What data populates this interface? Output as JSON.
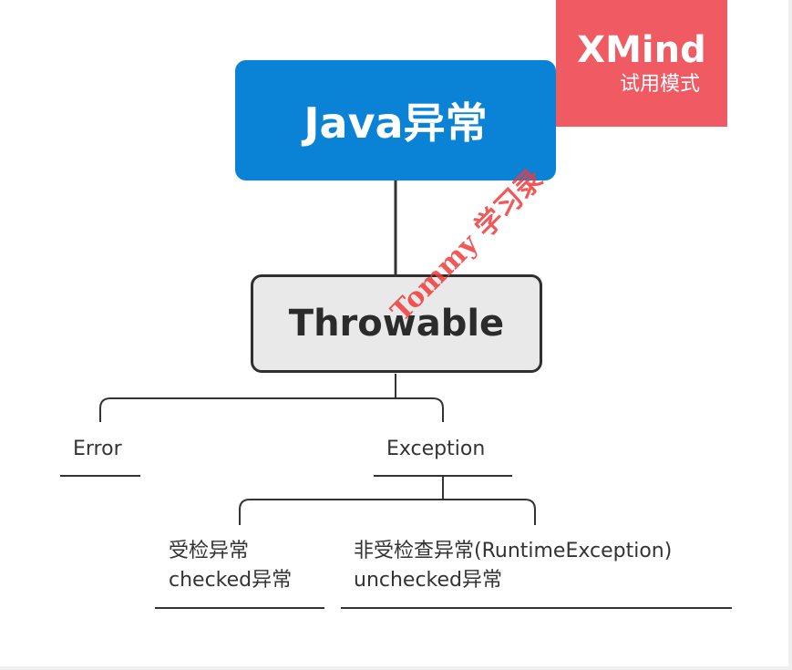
{
  "root": {
    "label": "Java异常"
  },
  "level1": {
    "label": "Throwable"
  },
  "level2": [
    {
      "label": "Error"
    },
    {
      "label": "Exception"
    }
  ],
  "level3": [
    {
      "line1": "受检异常",
      "line2": "checked异常"
    },
    {
      "line1": "非受检查异常(RuntimeException)",
      "line2": "unchecked异常"
    }
  ],
  "badge": {
    "title": "XMind",
    "subtitle": "试用模式"
  },
  "watermark": {
    "text": "Tommy 学习录"
  },
  "colors": {
    "root": "#0a83d6",
    "badge": "#ef5a63",
    "node": "#e9e9e9",
    "line": "#333333",
    "watermark": "#f03b3b"
  }
}
